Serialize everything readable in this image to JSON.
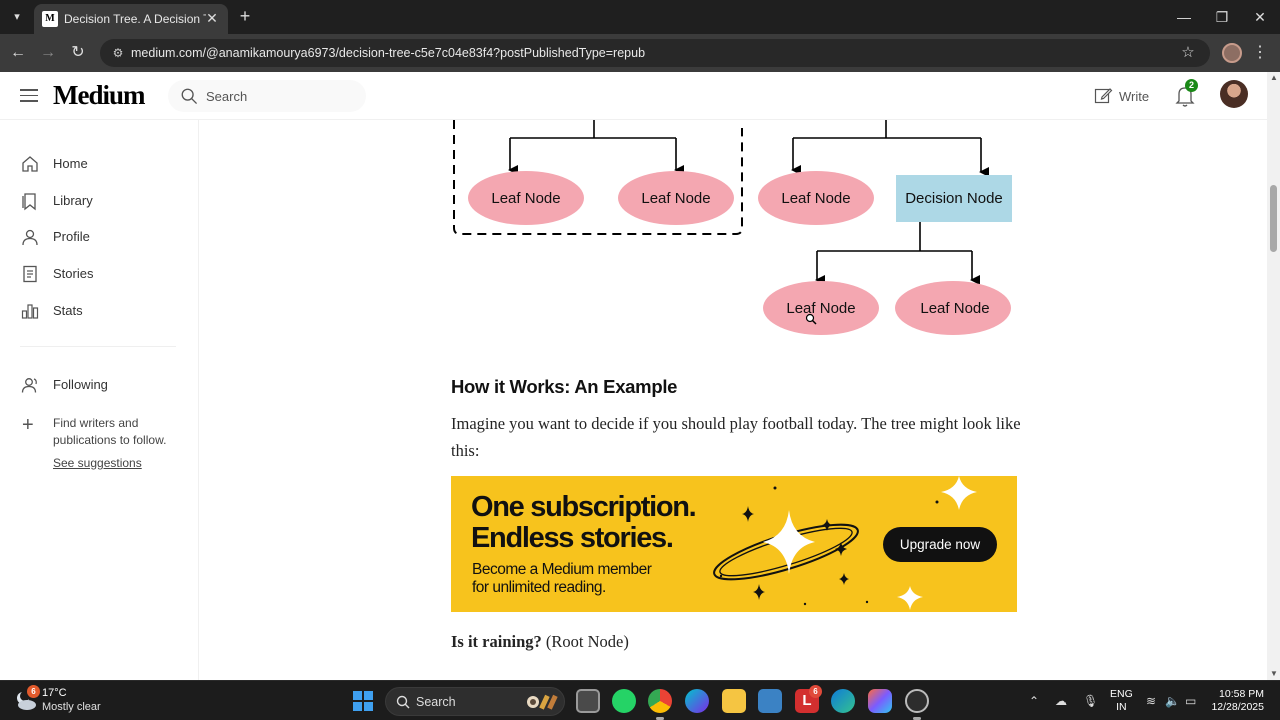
{
  "browser": {
    "tab_title": "Decision Tree. A Decision Tree is a...",
    "tab_favicon": "M",
    "url": "medium.com/@anamikamourya6973/decision-tree-c5e7c04e83f4?postPublishedType=repub",
    "icons": [
      "tab-list-icon",
      "close-icon",
      "plus-icon",
      "back-icon",
      "forward-icon",
      "reload-icon",
      "site-info-icon",
      "star-icon",
      "more-icon"
    ]
  },
  "medium": {
    "logo": "Medium",
    "search_placeholder": "Search",
    "write_label": "Write",
    "notification_count": "2",
    "brand_color": "#1a8917"
  },
  "sidebar": {
    "items": [
      {
        "label": "Home",
        "icon": "home-icon"
      },
      {
        "label": "Library",
        "icon": "bookmark-icon"
      },
      {
        "label": "Profile",
        "icon": "person-icon"
      },
      {
        "label": "Stories",
        "icon": "document-icon"
      },
      {
        "label": "Stats",
        "icon": "bar-chart-icon"
      }
    ],
    "following": {
      "label": "Following",
      "icon": "people-icon"
    },
    "find_writers": "Find writers and publications to follow.",
    "see_suggestions": "See suggestions"
  },
  "diagram": {
    "nodes": {
      "leaf_1": "Leaf Node",
      "leaf_2": "Leaf Node",
      "leaf_3": "Leaf Node",
      "decision": "Decision Node",
      "leaf_4": "Leaf Node",
      "leaf_5": "Leaf Node"
    },
    "leaf_color": "#f4a7b1",
    "decision_color": "#add8e6"
  },
  "article": {
    "heading": "How it Works: An Example",
    "paragraph": "Imagine you want to decide if you should play football today. The tree might look like this:",
    "question_bold": "Is it raining?",
    "question_note": " (Root Node)"
  },
  "promo": {
    "line1": "One subscription.",
    "line2": "Endless stories.",
    "sub1": "Become a Medium member",
    "sub2": "for unlimited reading.",
    "button": "Upgrade now",
    "background": "#f7c31d"
  },
  "taskbar": {
    "weather_badge": "6",
    "temperature": "17°C",
    "condition": "Mostly clear",
    "search_label": "Search",
    "apps": [
      "task-view-icon",
      "whatsapp-icon",
      "chrome-icon",
      "canva-icon",
      "file-explorer-icon",
      "store-icon",
      "l-app-icon",
      "edge-icon",
      "copilot-icon",
      "settings-icon"
    ],
    "l_app_badge": "6",
    "lang_line1": "ENG",
    "lang_line2": "IN",
    "time": "10:58 PM",
    "date": "12/28/2025"
  }
}
